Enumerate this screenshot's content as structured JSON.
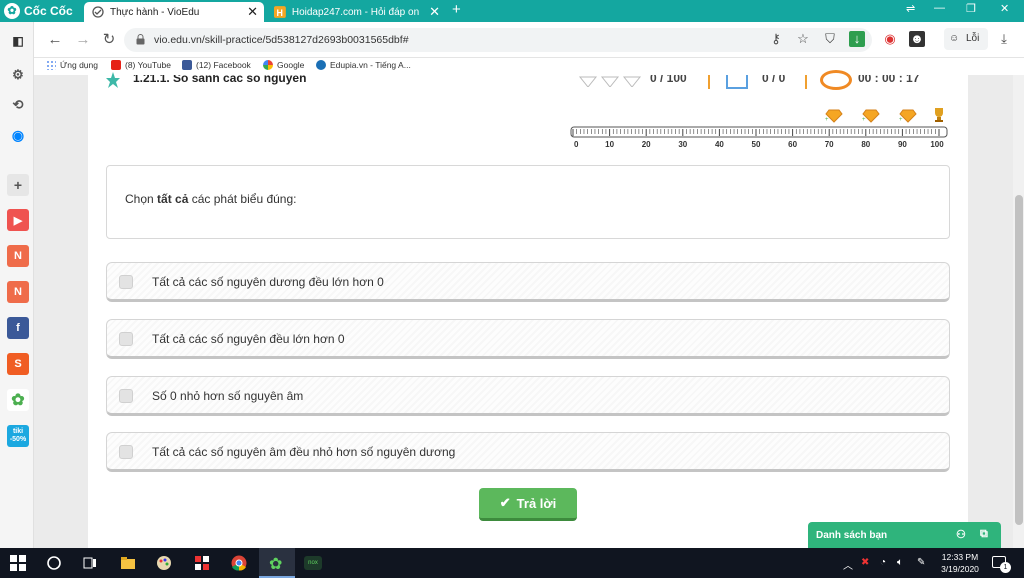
{
  "browser": {
    "brand": "Cốc Cốc",
    "tabs": [
      {
        "title": "Thực hành - VioEdu"
      },
      {
        "title": "Hoidap247.com - Hỏi đáp on"
      }
    ],
    "url": "vio.edu.vn/skill-practice/5d538127d2693b0031565dbf#",
    "profile_label": "Lỗi"
  },
  "bookmarks": [
    {
      "label": "Ứng dụng"
    },
    {
      "label": "(8) YouTube"
    },
    {
      "label": "(12) Facebook"
    },
    {
      "label": "Google"
    },
    {
      "label": "Edupia.vn - Tiếng A..."
    }
  ],
  "lesson": {
    "title": "1.21.1. So sánh các số nguyên",
    "score": "0 / 100",
    "answered": "0 / 0",
    "timer": "00 : 00 : 17"
  },
  "progress_ticks": [
    "0",
    "10",
    "20",
    "30",
    "40",
    "50",
    "60",
    "70",
    "80",
    "90",
    "100"
  ],
  "question": {
    "prompt_prefix": "Chọn",
    "prompt_bold": "tất cả",
    "prompt_suffix": "các phát biểu đúng:"
  },
  "options": [
    {
      "text": "Tất cả các số nguyên dương đều lớn hơn 0"
    },
    {
      "text": "Tất cả các số nguyên đều lớn hơn 0"
    },
    {
      "text": "Số 0 nhỏ hơn số nguyên âm"
    },
    {
      "text": "Tất cả các số nguyên âm đều nhỏ hơn số nguyên dương"
    }
  ],
  "answer_button": "Trả lời",
  "friends_panel": "Danh sách bạn",
  "taskbar": {
    "time": "12:33 PM",
    "date": "3/19/2020",
    "notification_count": "1"
  },
  "colors": {
    "titlebar": "#14a7a0",
    "answer_button": "#5cb85c",
    "friends_panel": "#2fb47c"
  }
}
